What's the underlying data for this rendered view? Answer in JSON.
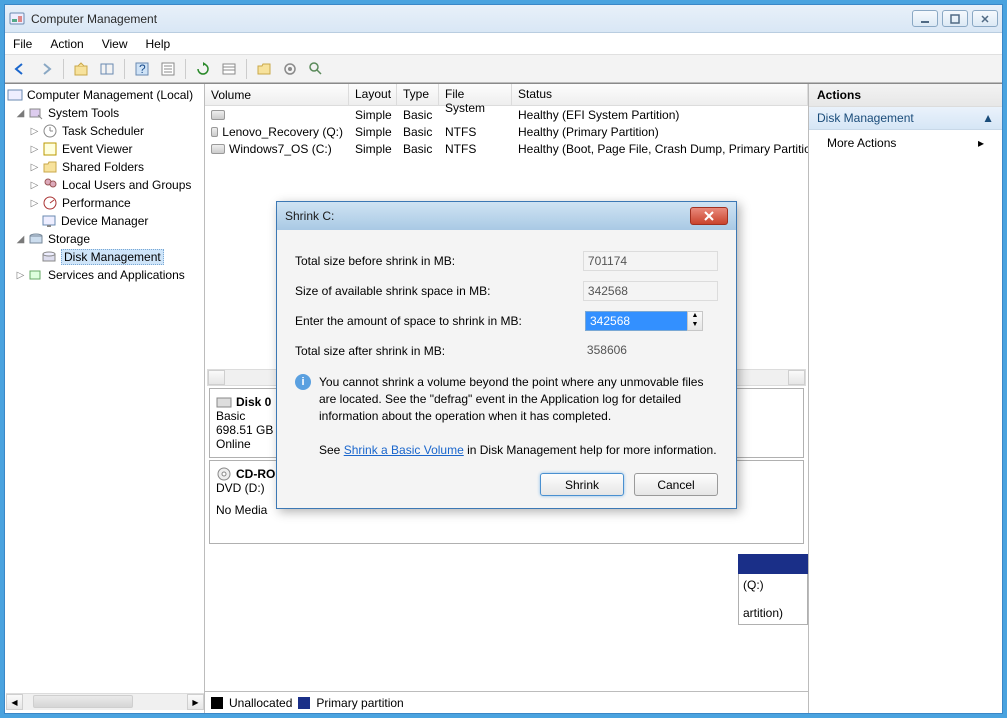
{
  "window": {
    "title": "Computer Management"
  },
  "menu": [
    "File",
    "Action",
    "View",
    "Help"
  ],
  "tree": {
    "root": "Computer Management (Local)",
    "n1": "System Tools",
    "n1a": "Task Scheduler",
    "n1b": "Event Viewer",
    "n1c": "Shared Folders",
    "n1d": "Local Users and Groups",
    "n1e": "Performance",
    "n1f": "Device Manager",
    "n2": "Storage",
    "n2a": "Disk Management",
    "n3": "Services and Applications"
  },
  "grid": {
    "headers": {
      "v": "Volume",
      "l": "Layout",
      "t": "Type",
      "f": "File System",
      "s": "Status"
    },
    "rows": [
      {
        "v": "",
        "l": "Simple",
        "t": "Basic",
        "f": "",
        "s": "Healthy (EFI System Partition)"
      },
      {
        "v": "Lenovo_Recovery (Q:)",
        "l": "Simple",
        "t": "Basic",
        "f": "NTFS",
        "s": "Healthy (Primary Partition)"
      },
      {
        "v": "Windows7_OS (C:)",
        "l": "Simple",
        "t": "Basic",
        "f": "NTFS",
        "s": "Healthy (Boot, Page File, Crash Dump, Primary Partition)"
      }
    ]
  },
  "disk0": {
    "name": "Disk 0",
    "type": "Basic",
    "size": "698.51 GB",
    "status": "Online"
  },
  "cdrom": {
    "name": "CD-ROM",
    "type": "DVD (D:)",
    "status": "No Media"
  },
  "legend": {
    "unalloc": "Unallocated",
    "primary": "Primary partition"
  },
  "actions": {
    "head": "Actions",
    "sect": "Disk Management",
    "item": "More Actions"
  },
  "dialog": {
    "title": "Shrink C:",
    "rows": {
      "total_before_lbl": "Total size before shrink in MB:",
      "total_before_val": "701174",
      "avail_lbl": "Size of available shrink space in MB:",
      "avail_val": "342568",
      "enter_lbl": "Enter the amount of space to shrink in MB:",
      "enter_val": "342568",
      "total_after_lbl": "Total size after shrink in MB:",
      "total_after_val": "358606"
    },
    "info1": "You cannot shrink a volume beyond the point where any unmovable files are located. See the \"defrag\" event in the Application log for detailed information about the operation when it has completed.",
    "see": "See ",
    "link": "Shrink a Basic Volume",
    "see2": " in Disk Management help for more information.",
    "shrink": "Shrink",
    "cancel": "Cancel"
  },
  "partprev": {
    "name": "(Q:)",
    "status": "artition)"
  }
}
